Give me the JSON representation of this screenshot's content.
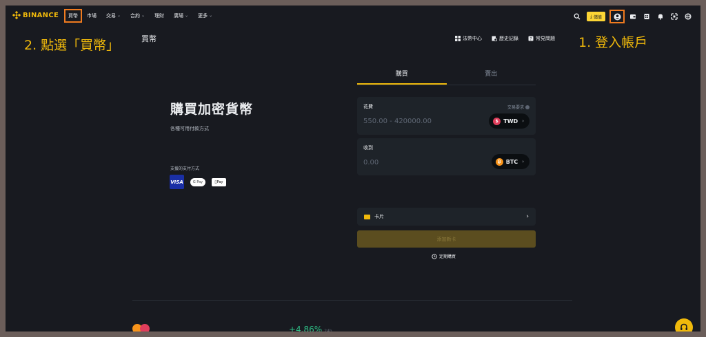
{
  "nav": {
    "logo_text": "BINANCE",
    "menu": [
      {
        "label": "買幣",
        "dropdown": false
      },
      {
        "label": "市場",
        "dropdown": false
      },
      {
        "label": "交易",
        "dropdown": true
      },
      {
        "label": "合約",
        "dropdown": true
      },
      {
        "label": "理財",
        "dropdown": false
      },
      {
        "label": "廣場",
        "dropdown": true
      },
      {
        "label": "更多",
        "dropdown": true
      }
    ],
    "deposit_label": "儲值",
    "icons": [
      "search-icon",
      "download-icon",
      "account-icon",
      "wallet-icon",
      "orders-icon",
      "bell-icon",
      "qr-download-icon",
      "globe-icon"
    ]
  },
  "annotations": {
    "step2": "2. 點選「買幣」",
    "step1": "1. 登入帳戶"
  },
  "page": {
    "title": "買幣",
    "subnav": [
      {
        "label": "法幣中心",
        "icon": "grid-icon"
      },
      {
        "label": "歷史記錄",
        "icon": "history-icon"
      },
      {
        "label": "常見問題",
        "icon": "faq-icon"
      }
    ]
  },
  "hero": {
    "title": "購買加密貨幣",
    "subtitle": "各種可用付款方式",
    "payment_label": "支援的支付方式",
    "payment_methods": [
      "VISA",
      "G Pay",
      "Pay"
    ]
  },
  "trade": {
    "tabs": [
      "購買",
      "賣出"
    ],
    "active_tab": 0,
    "spend": {
      "label": "花費",
      "hint": "交易要求",
      "placeholder": "550.00 - 420000.00",
      "currency": "TWD",
      "coin_glyph": "$"
    },
    "receive": {
      "label": "收到",
      "placeholder": "0.00",
      "currency": "BTC",
      "coin_glyph": "₿"
    },
    "payment_row": {
      "label": "卡片",
      "arrow": "›"
    },
    "add_card_label": "添加新卡",
    "recurring_label": "定期購買"
  },
  "bottom": {
    "percent": "+4.86%",
    "percent_suffix": "24h"
  },
  "colors": {
    "accent": "#f0b90b",
    "highlight_box": "#f07b1f",
    "background": "#181a20",
    "panel": "#1e2329",
    "positive": "#2ebd85"
  }
}
